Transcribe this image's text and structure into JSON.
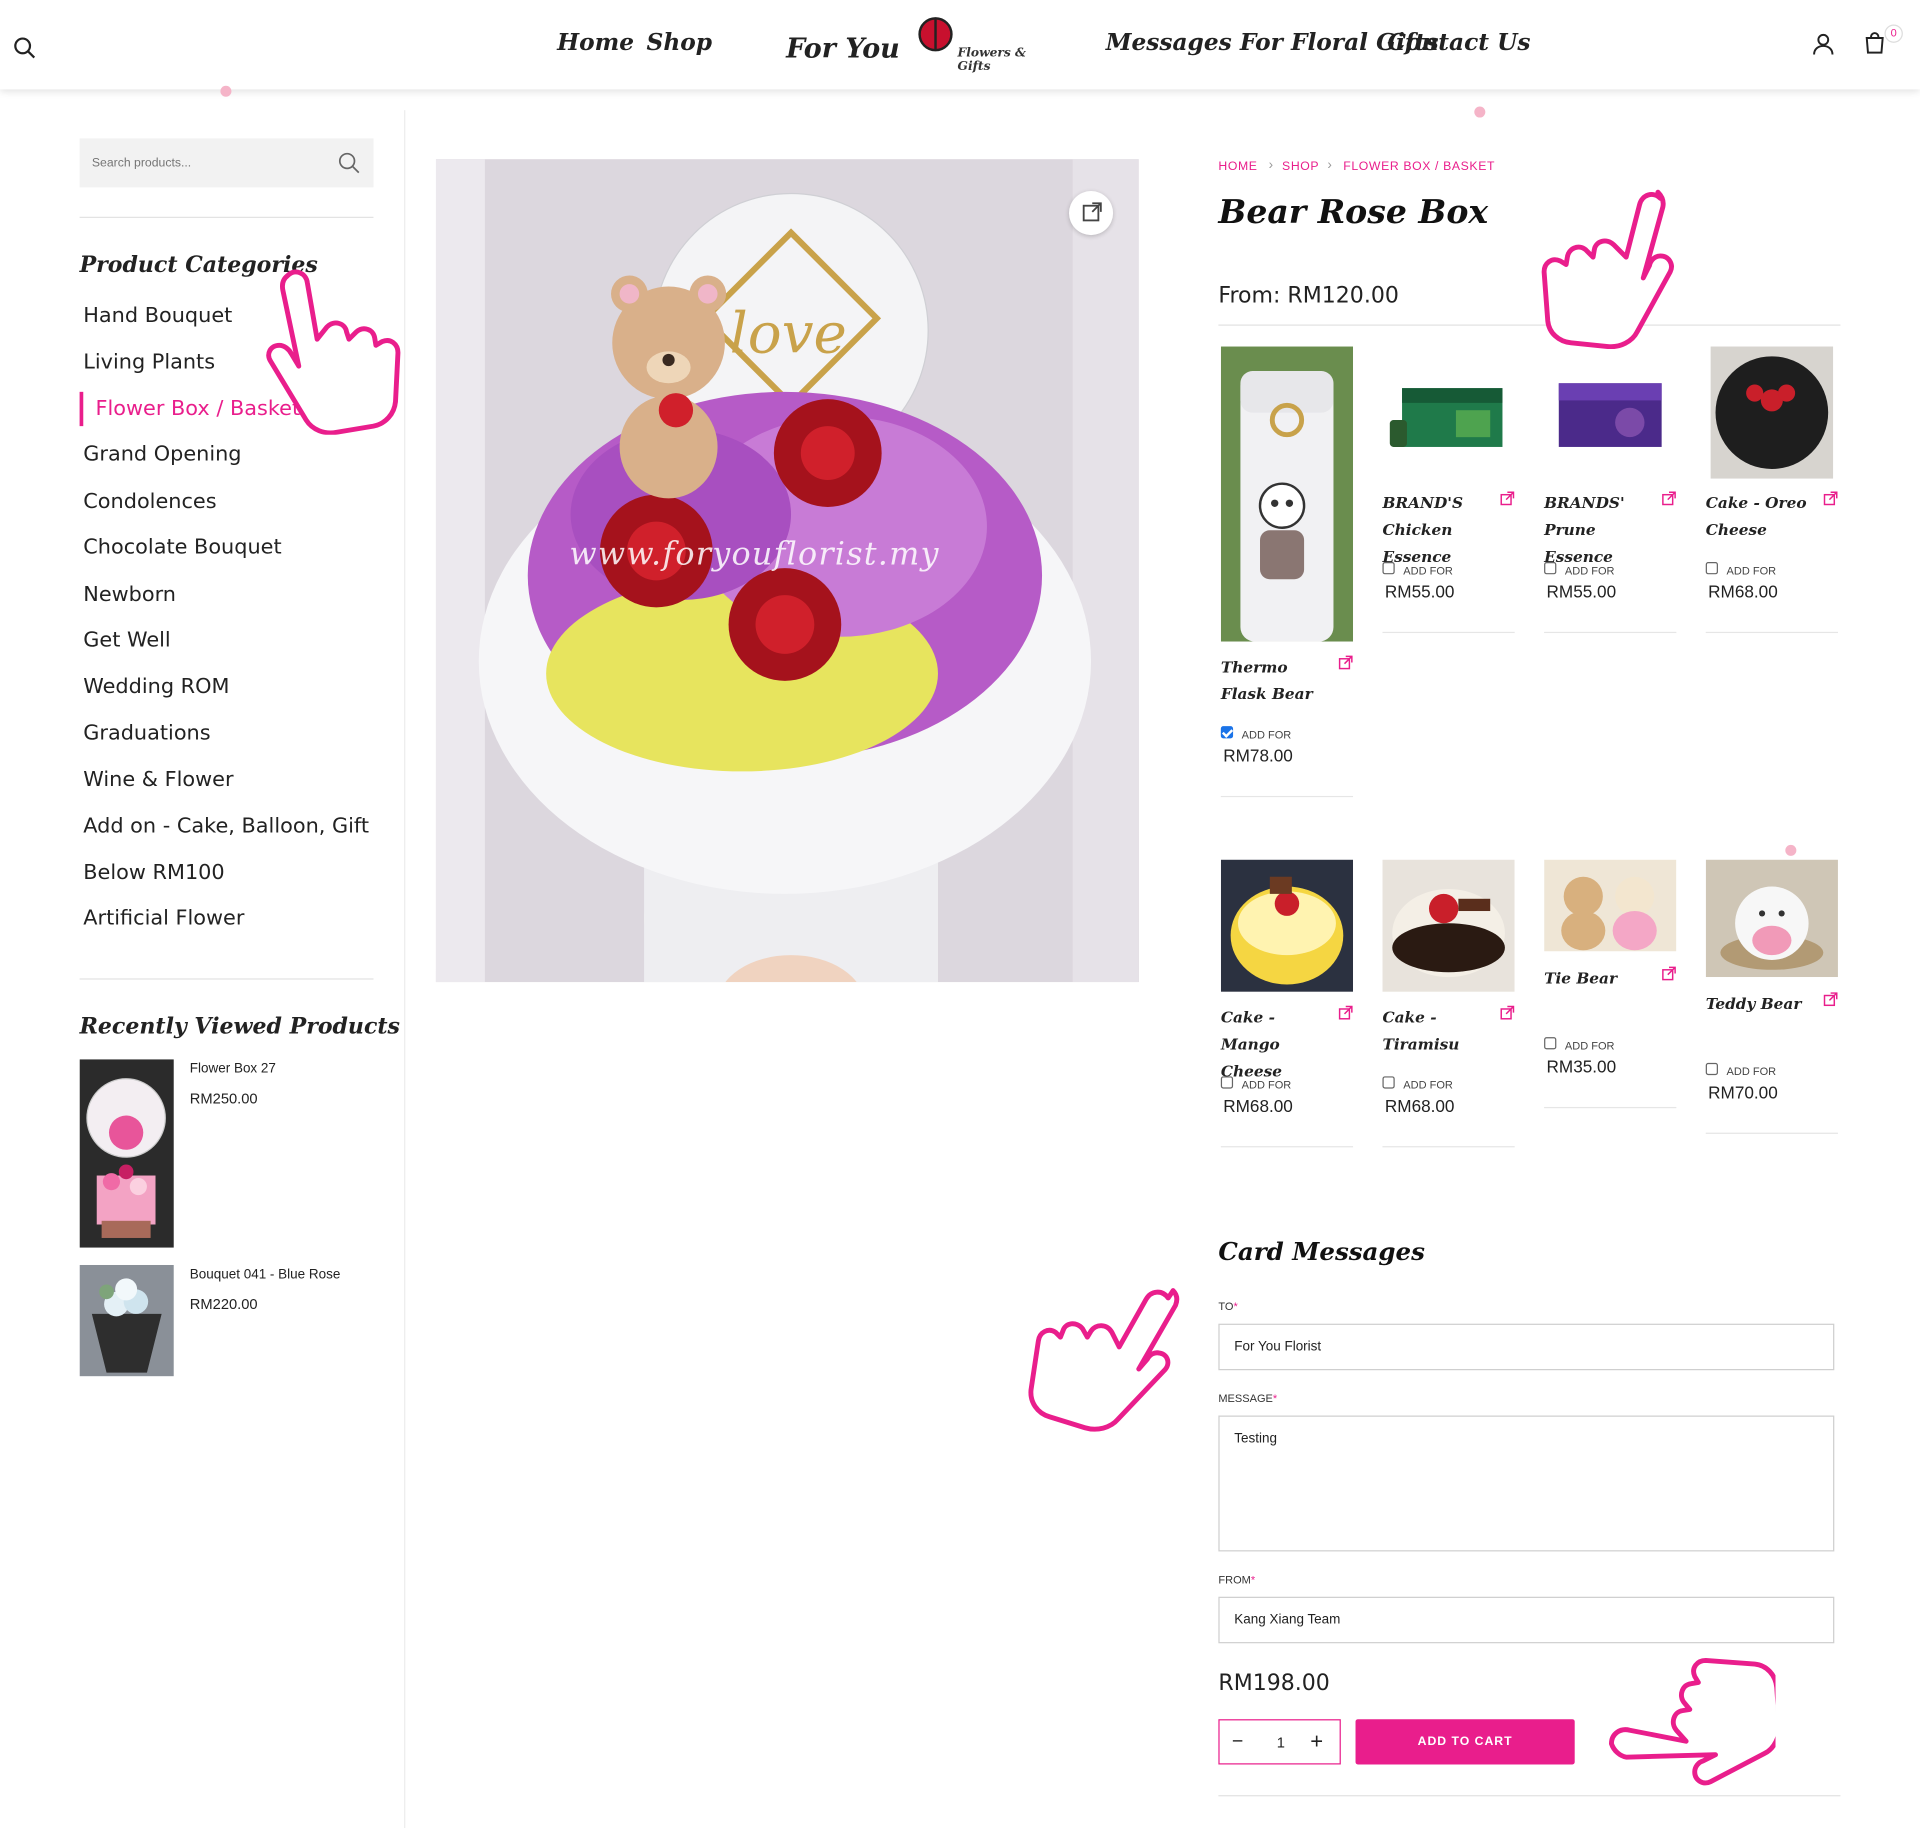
{
  "header": {
    "nav": [
      "Home",
      "Shop",
      "Messages For Floral Gifts",
      "Contact Us"
    ],
    "logo_main": "For You",
    "logo_sub": "Flowers & Gifts",
    "cart_count": "0"
  },
  "sidebar": {
    "search_placeholder": "Search products...",
    "categories_title": "Product Categories",
    "categories": [
      "Hand Bouquet",
      "Living Plants",
      "Flower Box / Basket",
      "Grand Opening",
      "Condolences",
      "Chocolate Bouquet",
      "Newborn",
      "Get Well",
      "Wedding ROM",
      "Graduations",
      "Wine & Flower",
      "Add on - Cake, Balloon, Gift",
      "Below RM100",
      "Artificial Flower"
    ],
    "active_category": "Flower Box / Basket",
    "recent_title": "Recently Viewed Products",
    "recent": [
      {
        "name": "Flower Box 27",
        "price": "RM250.00"
      },
      {
        "name": "Bouquet 041 - Blue Rose",
        "price": "RM220.00"
      }
    ]
  },
  "product": {
    "breadcrumb": [
      "HOME",
      "SHOP",
      "FLOWER BOX / BASKET"
    ],
    "title": "Bear Rose Box",
    "price_from": "From: RM120.00",
    "watermark": "www.foryouflorist.my"
  },
  "addons": [
    {
      "name": "Thermo Flask Bear",
      "add_for": "ADD FOR",
      "price": "RM78.00",
      "checked": true
    },
    {
      "name": "BRAND'S Chicken Essence",
      "add_for": "ADD FOR",
      "price": "RM55.00",
      "checked": false
    },
    {
      "name": "BRANDS' Prune Essence",
      "add_for": "ADD FOR",
      "price": "RM55.00",
      "checked": false
    },
    {
      "name": "Cake - Oreo Cheese",
      "add_for": "ADD FOR",
      "price": "RM68.00",
      "checked": false
    },
    {
      "name": "Cake - Mango Cheese",
      "add_for": "ADD FOR",
      "price": "RM68.00",
      "checked": false
    },
    {
      "name": "Cake - Tiramisu",
      "add_for": "ADD FOR",
      "price": "RM68.00",
      "checked": false
    },
    {
      "name": "Tie Bear",
      "add_for": "ADD FOR",
      "price": "RM35.00",
      "checked": false
    },
    {
      "name": "Teddy Bear",
      "add_for": "ADD FOR",
      "price": "RM70.00",
      "checked": false
    }
  ],
  "card_messages": {
    "title": "Card Messages",
    "to_label": "TO",
    "to_value": "For You Florist",
    "message_label": "MESSAGE",
    "message_value": "Testing",
    "from_label": "FROM",
    "from_value": "Kang Xiang Team",
    "required_mark": "*"
  },
  "purchase": {
    "total": "RM198.00",
    "qty": "1",
    "minus": "−",
    "plus": "+",
    "add_to_cart": "ADD TO CART"
  },
  "colors": {
    "accent": "#e91e8c"
  }
}
